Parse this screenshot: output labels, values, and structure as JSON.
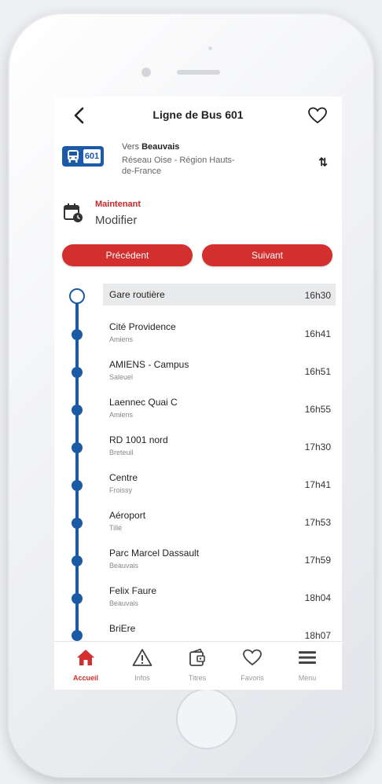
{
  "header": {
    "title": "Ligne de Bus 601"
  },
  "route": {
    "line_number": "601",
    "direction_prefix": "Vers",
    "direction_dest": "Beauvais",
    "network": "Réseau Oise - Région Hauts-de-France"
  },
  "time": {
    "now_label": "Maintenant",
    "modify_label": "Modifier"
  },
  "nav": {
    "prev_label": "Précédent",
    "next_label": "Suivant"
  },
  "stops": [
    {
      "name": "Gare routière",
      "city": "",
      "time": "16h30"
    },
    {
      "name": "Cité Providence",
      "city": "Amiens",
      "time": "16h41"
    },
    {
      "name": "AMIENS - Campus",
      "city": "Saleuel",
      "time": "16h51"
    },
    {
      "name": "Laennec Quai C",
      "city": "Amiens",
      "time": "16h55"
    },
    {
      "name": "RD 1001 nord",
      "city": "Breteuil",
      "time": "17h30"
    },
    {
      "name": "Centre",
      "city": "Froissy",
      "time": "17h41"
    },
    {
      "name": "Aéroport",
      "city": "Tillé",
      "time": "17h53"
    },
    {
      "name": "Parc Marcel Dassault",
      "city": "Beauvais",
      "time": "17h59"
    },
    {
      "name": "Felix Faure",
      "city": "Beauvais",
      "time": "18h04"
    },
    {
      "name": "BriEre",
      "city": "",
      "time": "18h07"
    }
  ],
  "tabs": [
    {
      "label": "Accueil",
      "icon": "home-icon"
    },
    {
      "label": "Infos",
      "icon": "warning-icon"
    },
    {
      "label": "Titres",
      "icon": "wallet-icon"
    },
    {
      "label": "Favoris",
      "icon": "heart-icon"
    },
    {
      "label": "Menu",
      "icon": "menu-icon"
    }
  ],
  "colors": {
    "accent": "#d32f2f",
    "line": "#1b5aa6"
  }
}
